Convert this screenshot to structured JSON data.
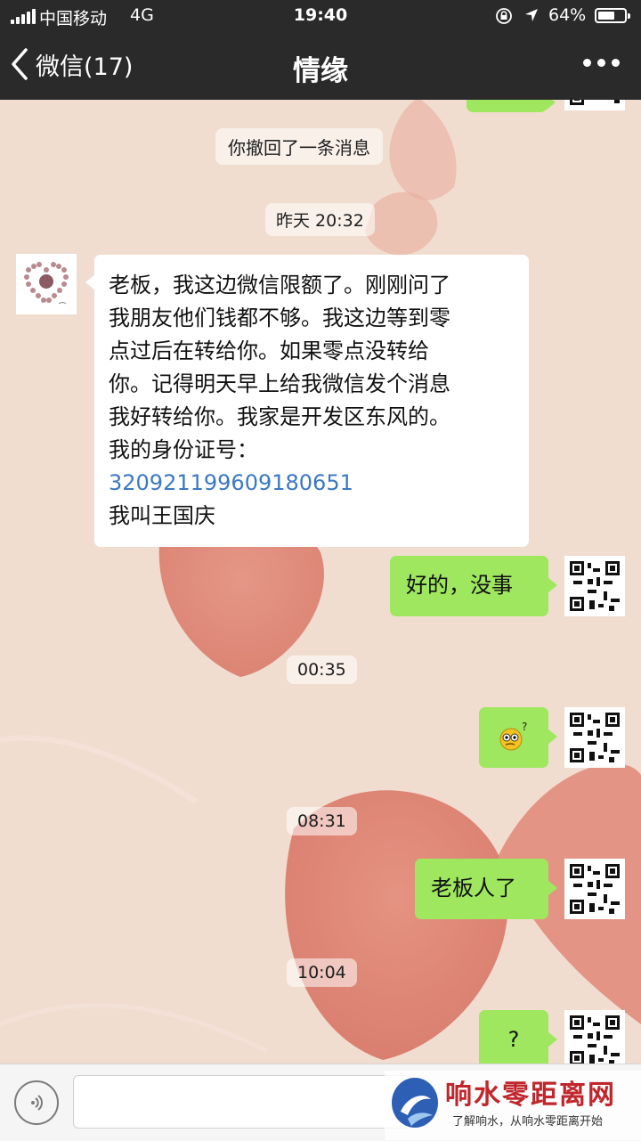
{
  "status_bar": {
    "carrier": "中国移动",
    "network": "4G",
    "time": "19:40",
    "battery_percent": "64%",
    "battery_level": 0.64
  },
  "nav": {
    "back_label": "微信(17)",
    "title": "情缘"
  },
  "messages": [
    {
      "type": "system",
      "text": "你撤回了一条消息"
    },
    {
      "type": "time",
      "text": "昨天 20:32"
    },
    {
      "type": "incoming",
      "lines": [
        "老板，我这边微信限额了。刚刚问了",
        "我朋友他们钱都不够。我这边等到零",
        "点过后在转给你。如果零点没转给",
        "你。记得明天早上给我微信发个消息",
        "我好转给你。我家是开发区东风的。",
        "我的身份证号："
      ],
      "link": "320921199609180651",
      "last_line": "我叫王国庆"
    },
    {
      "type": "outgoing",
      "text": "好的，没事"
    },
    {
      "type": "time",
      "text": "00:35"
    },
    {
      "type": "outgoing",
      "emoji": "confused-face"
    },
    {
      "type": "time",
      "text": "08:31"
    },
    {
      "type": "outgoing",
      "text": "老板人了"
    },
    {
      "type": "time",
      "text": "10:04"
    },
    {
      "type": "outgoing",
      "text": "?"
    }
  ],
  "colors": {
    "header": "#2a2a2a",
    "outgoing_bubble": "#9fe75e",
    "incoming_bubble": "#ffffff",
    "link": "#3b78c4",
    "background": "#f1ddd0"
  },
  "watermark": {
    "main": "响水零距离网",
    "tagline": "了解响水，从响水零距离开始"
  }
}
